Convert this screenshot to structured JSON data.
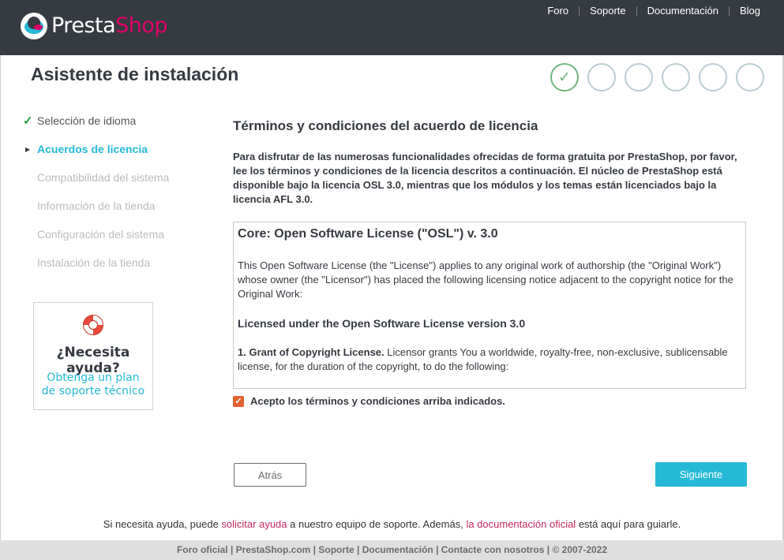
{
  "header": {
    "logo_part1": "Presta",
    "logo_part2": "Shop",
    "nav": [
      "Foro",
      "Soporte",
      "Documentación",
      "Blog"
    ]
  },
  "page_title": "Asistente de instalación",
  "progress": {
    "total_steps": 6,
    "completed_steps": 1,
    "check_glyph": "✓"
  },
  "sidebar": {
    "items": [
      {
        "label": "Selección de idioma",
        "state": "done",
        "marker": "✓"
      },
      {
        "label": "Acuerdos de licencia",
        "state": "active",
        "marker": "▶"
      },
      {
        "label": "Compatibilidad del sistema",
        "state": "pending",
        "marker": ""
      },
      {
        "label": "Información de la tienda",
        "state": "pending",
        "marker": ""
      },
      {
        "label": "Configuración del sistema",
        "state": "pending",
        "marker": ""
      },
      {
        "label": "Instalación de la tienda",
        "state": "pending",
        "marker": ""
      }
    ]
  },
  "help_box": {
    "icon": "lifebuoy-icon",
    "title": "¿Necesita ayuda?",
    "link": "Obtenga un plan de soporte técnico"
  },
  "main": {
    "title": "Términos y condiciones del acuerdo de licencia",
    "intro": "Para disfrutar de las numerosas funcionalidades ofrecidas de forma gratuita por PrestaShop, por favor, lee los términos y condiciones de la licencia descritos a continuación. El núcleo de PrestaShop está disponible bajo la licencia OSL 3.0, mientras que los módulos y los temas están licenciados bajo la licencia AFL 3.0.",
    "license": {
      "heading": "Core: Open Software License (\"OSL\") v. 3.0",
      "para1": "This Open Software License (the \"License\") applies to any original work of authorship (the \"Original Work\") whose owner (the \"Licensor\") has placed the following licensing notice adjacent to the copyright notice for the Original Work:",
      "subheading": "Licensed under the Open Software License version 3.0",
      "grant_title": "1. Grant of Copyright License.",
      "grant_text": " Licensor grants You a worldwide, royalty-free, non-exclusive, sublicensable license, for the duration of the copyright, to do the following:"
    },
    "accept_checked": true,
    "accept_label": "Acepto los términos y condiciones arriba indicados.",
    "back_label": "Atrás",
    "next_label": "Siguiente"
  },
  "help_line": {
    "before": "Si necesita ayuda, puede ",
    "link1": "solicitar ayuda",
    "middle": " a nuestro equipo de soporte. Además, ",
    "link2": "la documentación oficial",
    "after": " está aquí para guiarle."
  },
  "footer": "Foro oficial | PrestaShop.com | Soporte | Documentación | Contacte con nosotros | © 2007-2022",
  "colors": {
    "header_bg": "#363a41",
    "accent": "#25b9d7",
    "brand_pink": "#df0067",
    "step_done": "#70b580",
    "checkbox": "#e1612f"
  }
}
